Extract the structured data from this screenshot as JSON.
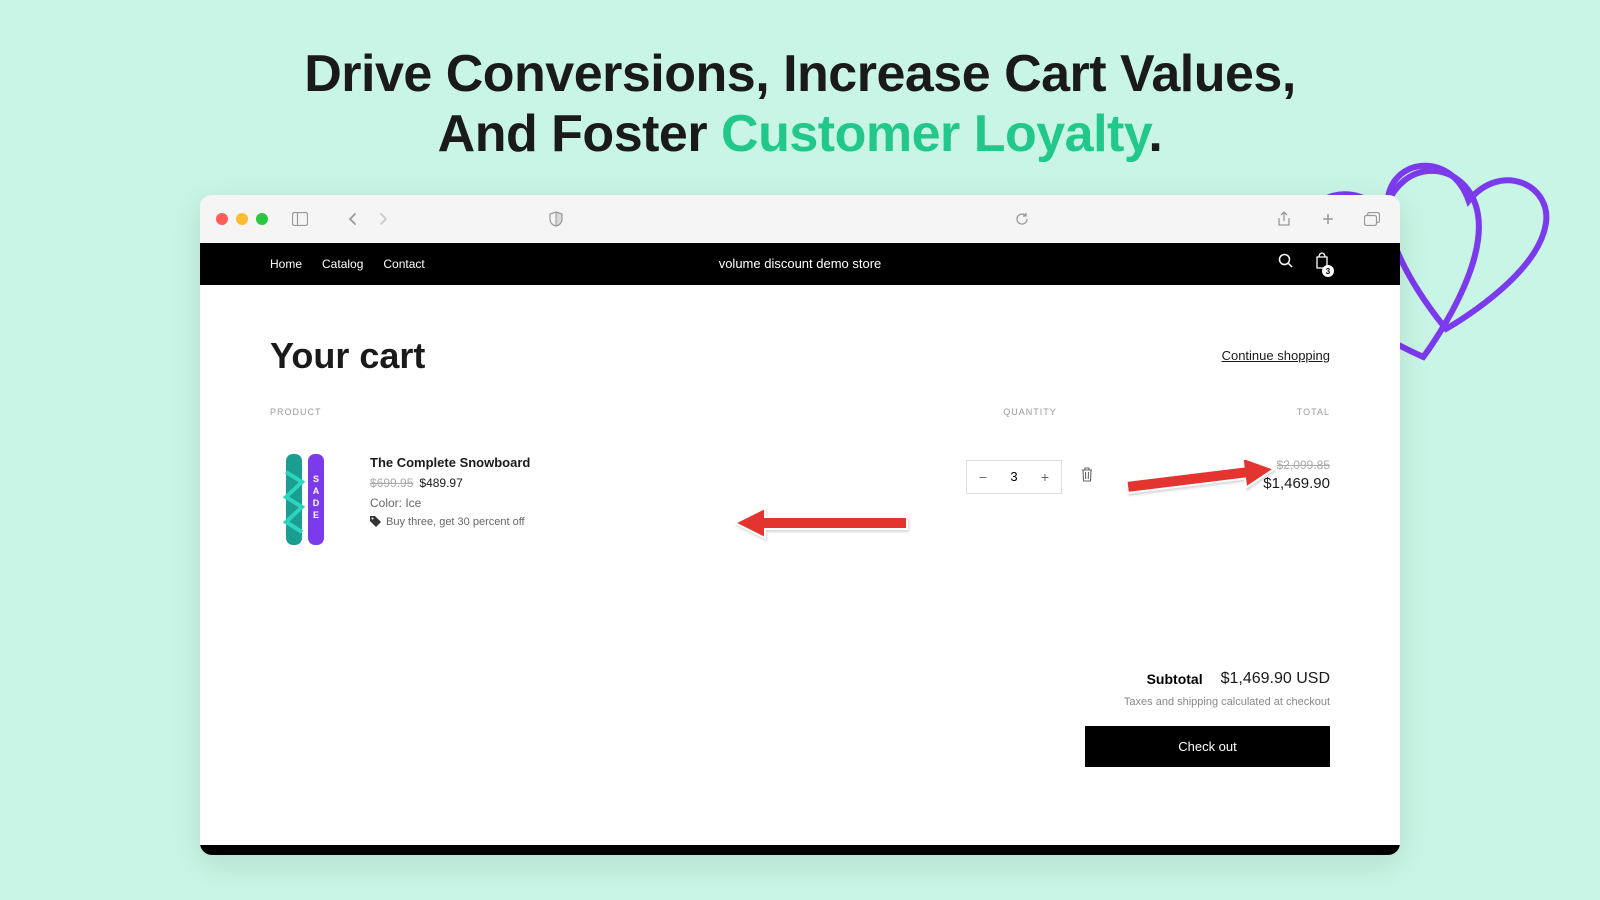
{
  "headline": {
    "line1": "Drive Conversions, Increase Cart Values,",
    "line2_prefix": "And Foster ",
    "line2_highlight": "Customer Loyalty",
    "line2_suffix": "."
  },
  "store": {
    "nav": {
      "home": "Home",
      "catalog": "Catalog",
      "contact": "Contact"
    },
    "title": "volume discount demo store",
    "cart_count": "3"
  },
  "cart": {
    "title": "Your cart",
    "continue_link": "Continue shopping",
    "columns": {
      "product": "PRODUCT",
      "quantity": "QUANTITY",
      "total": "TOTAL"
    },
    "item": {
      "name": "The Complete Snowboard",
      "price_old": "$699.95",
      "price_new": "$489.97",
      "variant": "Color: Ice",
      "discount": "Buy three, get 30 percent off",
      "quantity": "3",
      "line_total_old": "$2,099.85",
      "line_total_new": "$1,469.90"
    },
    "subtotal_label": "Subtotal",
    "subtotal_value": "$1,469.90 USD",
    "tax_note": "Taxes and shipping calculated at checkout",
    "checkout_button": "Check out"
  }
}
